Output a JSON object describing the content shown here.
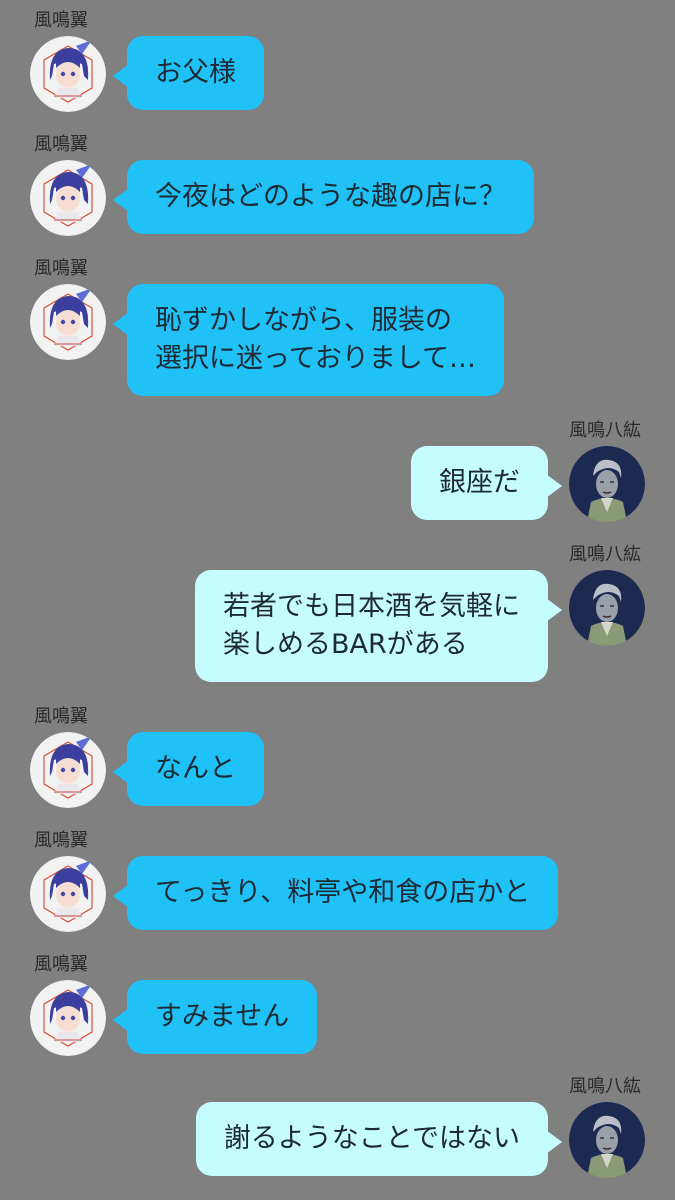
{
  "colors": {
    "background": "#808080",
    "left_bubble": "#1fc1f7",
    "right_bubble": "#c5fcfd",
    "text": "#1d2a33"
  },
  "participants": {
    "tsubasa": {
      "name": "風鳴翼",
      "avatar_icon": "tsubasa-avatar-icon",
      "avatar_caption": "風鳴 翼"
    },
    "yatsuhiro": {
      "name": "風鳴八紘",
      "avatar_icon": "yatsuhiro-avatar-icon"
    }
  },
  "messages": [
    {
      "side": "left",
      "sender": "風鳴翼",
      "lines": [
        "お父様"
      ]
    },
    {
      "side": "left",
      "sender": "風鳴翼",
      "lines": [
        "今夜はどのような趣の店に？"
      ]
    },
    {
      "side": "left",
      "sender": "風鳴翼",
      "lines": [
        "恥ずかしながら、服装の",
        "選択に迷っておりまして…"
      ]
    },
    {
      "side": "right",
      "sender": "風鳴八紘",
      "lines": [
        "銀座だ"
      ]
    },
    {
      "side": "right",
      "sender": "風鳴八紘",
      "lines": [
        "若者でも日本酒を気軽に",
        "楽しめるBARがある"
      ]
    },
    {
      "side": "left",
      "sender": "風鳴翼",
      "lines": [
        "なんと"
      ]
    },
    {
      "side": "left",
      "sender": "風鳴翼",
      "lines": [
        "てっきり、料亭や和食の店かと"
      ]
    },
    {
      "side": "left",
      "sender": "風鳴翼",
      "lines": [
        "すみません"
      ]
    },
    {
      "side": "right",
      "sender": "風鳴八紘",
      "lines": [
        "謝るようなことではない"
      ]
    }
  ]
}
